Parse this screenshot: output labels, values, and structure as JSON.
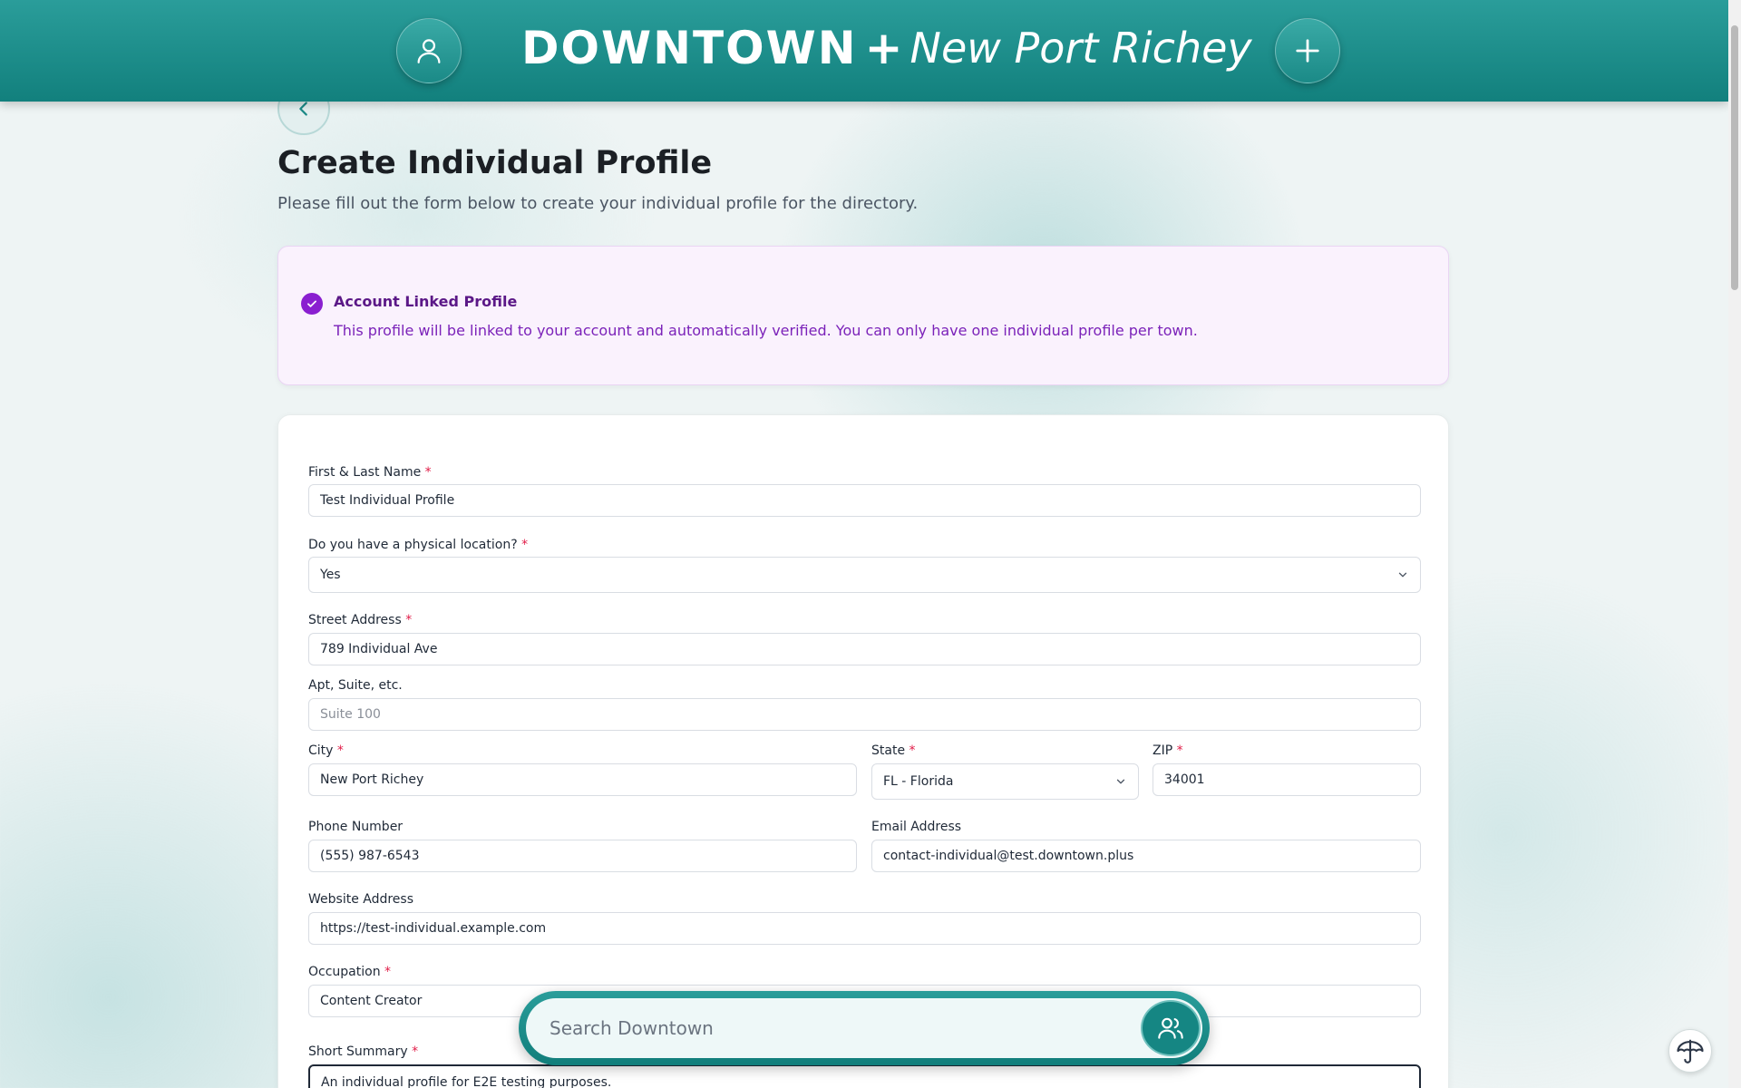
{
  "header": {
    "brand_main": "DOWNTOWN",
    "brand_plus": "+",
    "brand_town": "New Port Richey"
  },
  "page": {
    "title": "Create Individual Profile",
    "subtitle": "Please fill out the form below to create your individual profile for the directory."
  },
  "notice": {
    "title": "Account Linked Profile",
    "text": "This profile will be linked to your account and automatically verified. You can only have one individual profile per town."
  },
  "form": {
    "name": {
      "label": "First & Last Name",
      "req": "*",
      "value": "Test Individual Profile"
    },
    "physical": {
      "label": "Do you have a physical location?",
      "req": "*",
      "value": "Yes"
    },
    "street": {
      "label": "Street Address",
      "req": "*",
      "value": "789 Individual Ave"
    },
    "apt": {
      "label": "Apt, Suite, etc.",
      "placeholder": "Suite 100"
    },
    "city": {
      "label": "City",
      "req": "*",
      "value": "New Port Richey"
    },
    "state": {
      "label": "State",
      "req": "*",
      "value": "FL - Florida"
    },
    "zip": {
      "label": "ZIP",
      "req": "*",
      "value": "34001"
    },
    "phone": {
      "label": "Phone Number",
      "value": "(555) 987-6543"
    },
    "email": {
      "label": "Email Address",
      "value": "contact-individual@test.downtown.plus"
    },
    "website": {
      "label": "Website Address",
      "value": "https://test-individual.example.com"
    },
    "occupation": {
      "label": "Occupation",
      "req": "*",
      "value": "Content Creator"
    },
    "summary": {
      "label": "Short Summary",
      "req": "*",
      "value": "An individual profile for E2E testing purposes."
    }
  },
  "search": {
    "placeholder": "Search Downtown"
  },
  "icons": {
    "profile": "user-icon",
    "add": "plus-icon",
    "back": "chevron-left-icon",
    "check": "check-circle-icon",
    "chevron": "chevron-down-icon",
    "search_people": "users-icon",
    "help": "umbrella-icon"
  },
  "colors": {
    "header": "#1a8d8a",
    "notice_bg": "#faf2fd",
    "notice_accent": "#8a1fd0",
    "required": "#e11d48"
  }
}
